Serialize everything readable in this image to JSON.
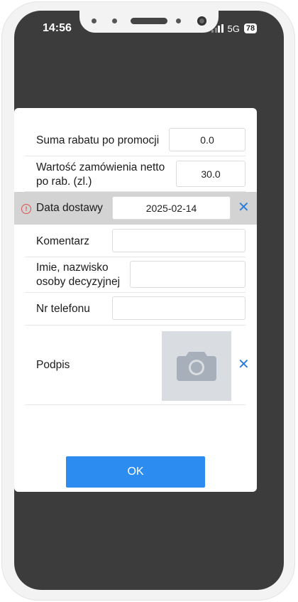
{
  "status_bar": {
    "time": "14:56",
    "network": "5G",
    "battery": "78"
  },
  "form": {
    "rows": [
      {
        "label": "Suma rabatu po promocji",
        "value": "0.0"
      },
      {
        "label": "Wartość zamówienia netto po rab. (zl.)",
        "value": "30.0"
      },
      {
        "label": "Data dostawy",
        "value": "2025-02-14",
        "error": true
      },
      {
        "label": "Komentarz",
        "value": ""
      },
      {
        "label": "Imie, nazwisko osoby decyzyjnej",
        "value": ""
      },
      {
        "label": "Nr telefonu",
        "value": ""
      },
      {
        "label": "Podpis"
      }
    ],
    "error_symbol": "!",
    "clear_symbol": "✕",
    "ok_label": "OK"
  },
  "colors": {
    "accent": "#2d8cf0",
    "error": "#d9534f",
    "highlight_row": "#d3d3d3",
    "backdrop": "#3c3c3c"
  },
  "icons": {
    "signature": "camera-icon",
    "date_error": "error-circle-icon",
    "clear": "clear-x-icon"
  }
}
